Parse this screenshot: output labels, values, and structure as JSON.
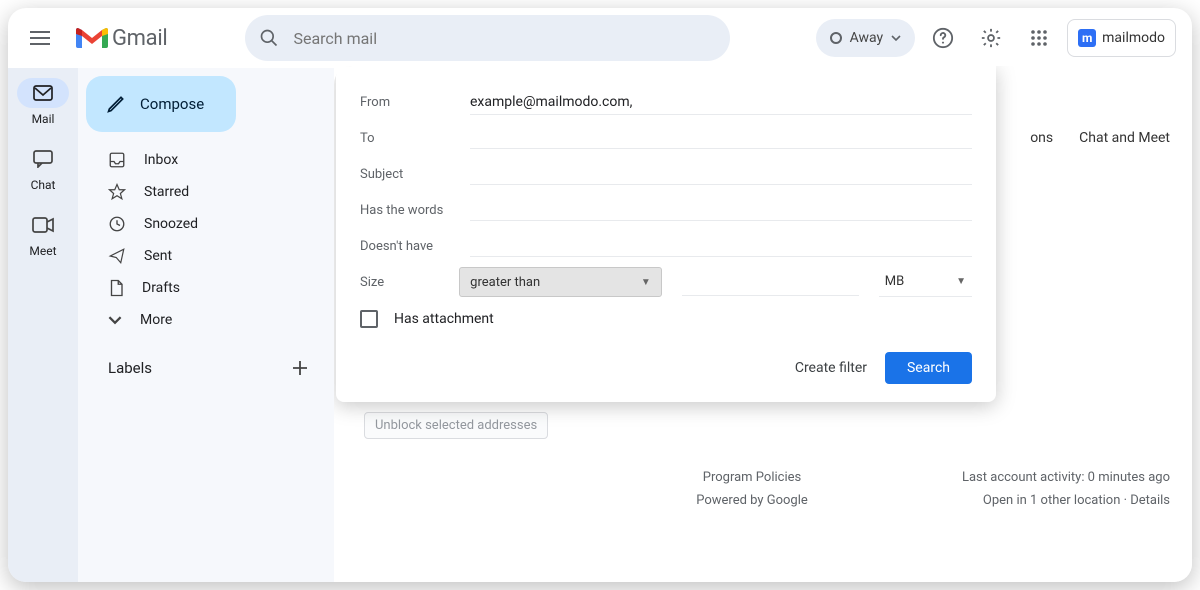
{
  "app": {
    "name": "Gmail"
  },
  "search": {
    "placeholder": "Search mail"
  },
  "status": {
    "label": "Away"
  },
  "addon": {
    "name": "mailmodo"
  },
  "rail": {
    "mail": "Mail",
    "chat": "Chat",
    "meet": "Meet"
  },
  "compose": {
    "label": "Compose"
  },
  "nav": {
    "inbox": "Inbox",
    "starred": "Starred",
    "snoozed": "Snoozed",
    "sent": "Sent",
    "drafts": "Drafts",
    "more": "More"
  },
  "labels": {
    "header": "Labels"
  },
  "filter": {
    "from_label": "From",
    "from_value": "example@mailmodo.com,",
    "to_label": "To",
    "subject_label": "Subject",
    "haswords_label": "Has the words",
    "nothave_label": "Doesn't have",
    "size_label": "Size",
    "size_op": "greater than",
    "size_unit": "MB",
    "attachment_label": "Has attachment",
    "create_filter": "Create filter",
    "search": "Search"
  },
  "bg": {
    "tab1": "ons",
    "tab2": "Chat and Meet",
    "unblock": "Unblock selected addresses"
  },
  "footer": {
    "policies": "Program Policies",
    "powered": "Powered by Google",
    "activity": "Last account activity: 0 minutes ago",
    "open_in": "Open in 1 other location · ",
    "details": "Details"
  }
}
